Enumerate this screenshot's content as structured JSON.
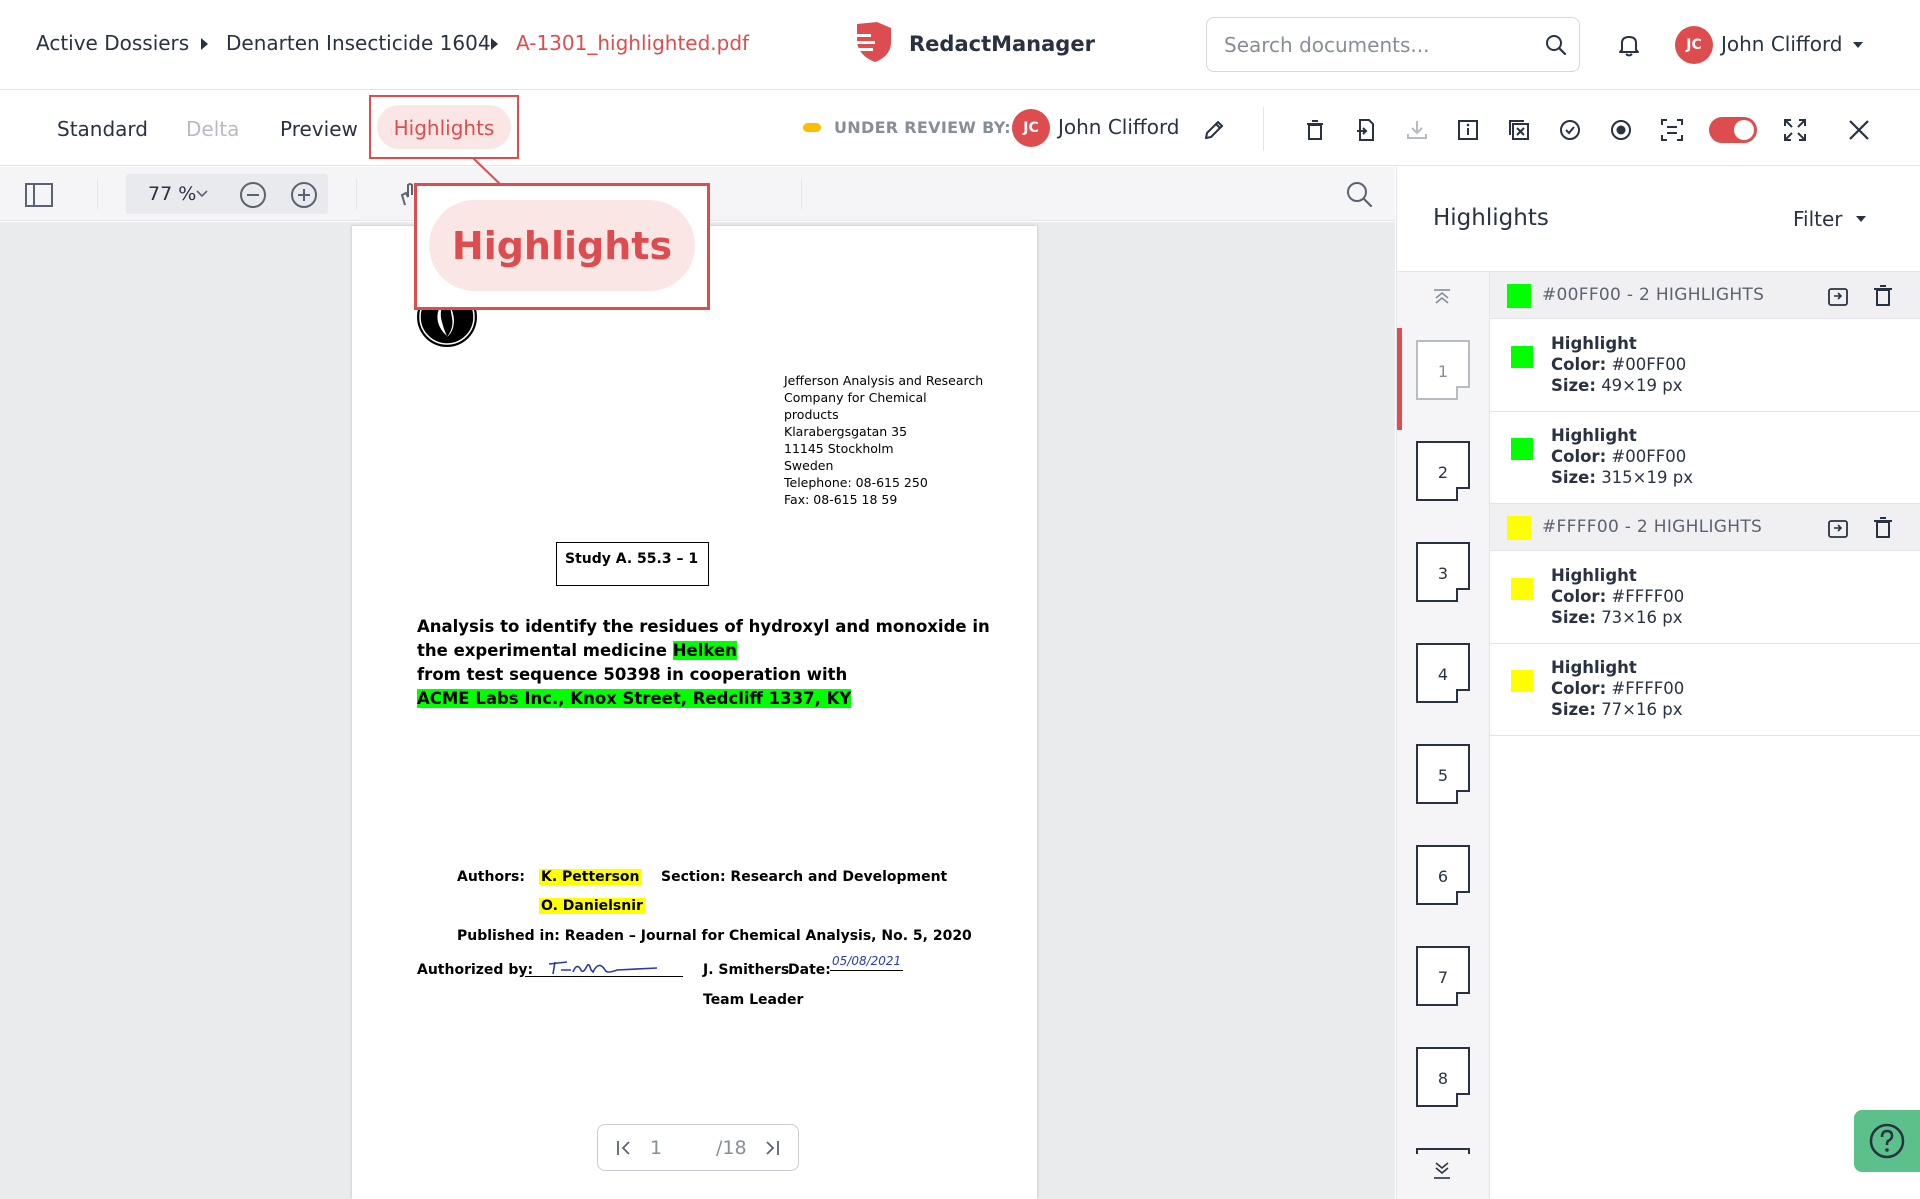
{
  "breadcrumb": {
    "items": [
      "Active Dossiers",
      "Denarten Insecticide 1604",
      "A-1301_highlighted.pdf"
    ]
  },
  "app": {
    "name": "RedactManager"
  },
  "search": {
    "placeholder": "Search documents..."
  },
  "user": {
    "initials": "JC",
    "name": "John Clifford"
  },
  "tabs": [
    "Standard",
    "Delta",
    "Preview",
    "Highlights"
  ],
  "status": {
    "label": "UNDER REVIEW BY:",
    "reviewer_initials": "JC",
    "reviewer_name": "John Clifford"
  },
  "viewer": {
    "zoom": "77 %",
    "page_current": "1",
    "page_total": "/18"
  },
  "zoom_callout": {
    "label": "Highlights"
  },
  "document": {
    "address": [
      "Jefferson Analysis and Research",
      "Company for Chemical",
      "products",
      "Klarabergsgatan 35",
      "11145 Stockholm",
      "Sweden",
      "Telephone: 08-615 250",
      "Fax: 08-615 18 59"
    ],
    "study": "Study A. 55.3 – 1",
    "title_line1": "Analysis to identify the residues of hydroxyl and monoxide in",
    "title_line2_prefix": "the experimental medicine ",
    "title_line2_highlight": "Helken",
    "title_line3": "from test sequence 50398 in cooperation with",
    "title_line4_highlight": "ACME Labs Inc., Knox Street, Redcliff 1337, KY",
    "authors_label": "Authors:",
    "author1": "K. Petterson",
    "author2": "O. Danielsnir",
    "section": "Section: Research and Development",
    "published": "Published in: Readen – Journal for Chemical Analysis, No. 5, 2020",
    "authorized_label": "Authorized by:",
    "signer": "J. Smithers",
    "date_label": "Date:",
    "date_value": "05/08/2021",
    "role": "Team Leader"
  },
  "panel": {
    "title": "Highlights",
    "filter_label": "Filter",
    "pages": [
      "1",
      "2",
      "3",
      "4",
      "5",
      "6",
      "7",
      "8"
    ],
    "groups": [
      {
        "label": "#00FF00 - 2 HIGHLIGHTS",
        "color": "#00FF00",
        "items": [
          {
            "title": "Highlight",
            "color_label": "Color:",
            "color_value": "#00FF00",
            "size_label": "Size:",
            "size_value": "49×19 px"
          },
          {
            "title": "Highlight",
            "color_label": "Color:",
            "color_value": "#00FF00",
            "size_label": "Size:",
            "size_value": "315×19 px"
          }
        ]
      },
      {
        "label": "#FFFF00 - 2 HIGHLIGHTS",
        "color": "#FFFF00",
        "items": [
          {
            "title": "Highlight",
            "color_label": "Color:",
            "color_value": "#FFFF00",
            "size_label": "Size:",
            "size_value": "73×16 px"
          },
          {
            "title": "Highlight",
            "color_label": "Color:",
            "color_value": "#FFFF00",
            "size_label": "Size:",
            "size_value": "77×16 px"
          }
        ]
      }
    ]
  },
  "colors": {
    "accent": "#dd4d50",
    "status": "#fdbd00",
    "help": "#5bc08a"
  },
  "icons": [
    "redactmanager-logo",
    "search-icon",
    "bell-icon",
    "edit-icon",
    "trash-icon",
    "export-icon",
    "download-icon",
    "info-icon",
    "exclude-icon",
    "approve-icon",
    "record-icon",
    "ocr-icon",
    "toggle",
    "fullscreen-icon",
    "close-icon",
    "sidebar-toggle-icon",
    "zoom-out-icon",
    "zoom-in-icon",
    "pan-icon",
    "pager-first-icon",
    "pager-last-icon",
    "help-icon",
    "scroll-top-icon",
    "scroll-bottom-icon",
    "copy-icon"
  ]
}
